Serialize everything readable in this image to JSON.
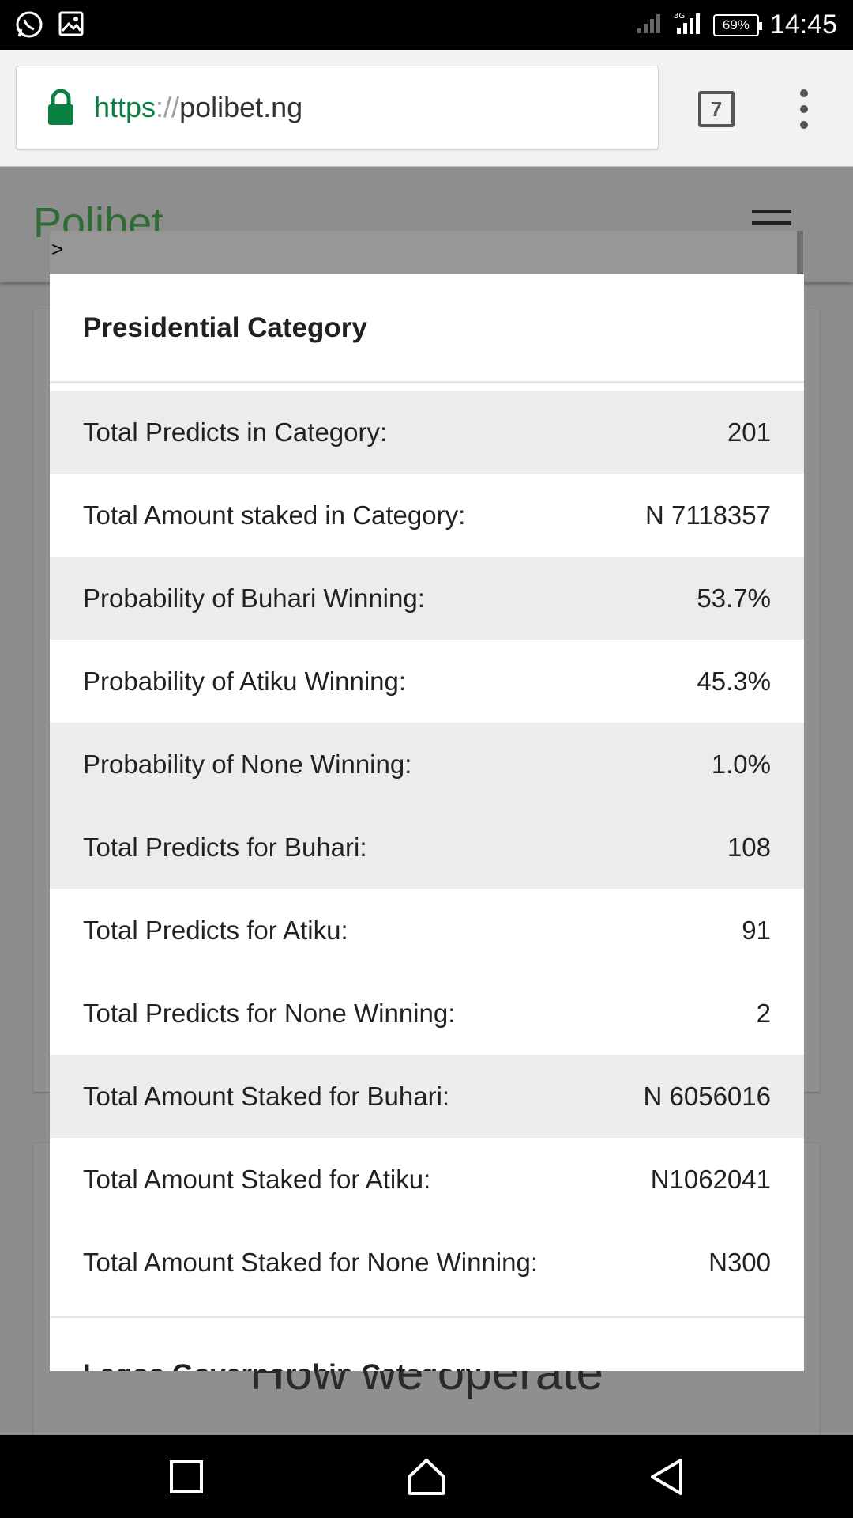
{
  "status_bar": {
    "battery": "69%",
    "time": "14:45",
    "icons": [
      "whatsapp-icon",
      "gallery-icon",
      "signal-icon",
      "signal-3g-icon",
      "battery-icon"
    ]
  },
  "browser": {
    "url_scheme": "https",
    "url_separator": "://",
    "url_host": "polibet.ng",
    "tab_count": "7",
    "colors": {
      "secure": "#0b8043"
    }
  },
  "site": {
    "brand": "Polibet",
    "brand_color": "#2f6b34",
    "how_heading": "How we operate"
  },
  "modal": {
    "arrow": ">",
    "title": "Presidential Category",
    "rows": [
      {
        "label": "Total Predicts in Category:",
        "value": "201"
      },
      {
        "label": "Total Amount staked in Category:",
        "value": "N 7118357"
      },
      {
        "label": "Probability of Buhari Winning:",
        "value": "53.7%"
      },
      {
        "label": "Probability of Atiku Winning:",
        "value": "45.3%"
      },
      {
        "label": "Probability of None Winning:",
        "value": "1.0%"
      },
      {
        "label": "Total Predicts for Buhari:",
        "value": "108"
      },
      {
        "label": "Total Predicts for Atiku:",
        "value": "91"
      },
      {
        "label": "Total Predicts for None Winning:",
        "value": "2"
      },
      {
        "label": "Total Amount Staked for Buhari:",
        "value": "N 6056016"
      },
      {
        "label": "Total Amount Staked for Atiku:",
        "value": "N1062041"
      },
      {
        "label": "Total Amount Staked for None Winning:",
        "value": "N300"
      }
    ],
    "next_section_title": "Lagos Governorship Category"
  },
  "nav_bar": {
    "buttons": [
      "recents-icon",
      "home-icon",
      "back-icon"
    ]
  }
}
